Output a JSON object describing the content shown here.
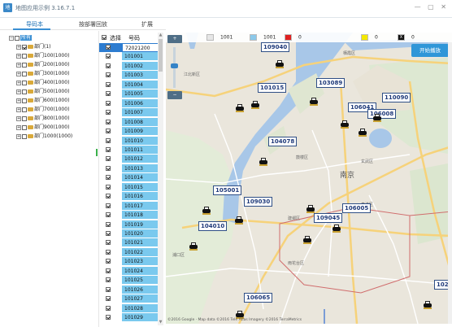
{
  "window": {
    "title": "地图应用示例 3.16.7.1",
    "app_icon_glyph": "地",
    "controls": "— ▢ ✕"
  },
  "tabs": [
    {
      "label": "导码本",
      "active": true
    },
    {
      "label": "按部署回放",
      "active": false
    },
    {
      "label": "扩展",
      "active": false
    }
  ],
  "tree": {
    "root_label": "所有",
    "items": [
      {
        "label": "部门(1)",
        "checked": true
      },
      {
        "label": "部门100(1000)",
        "checked": false
      },
      {
        "label": "部门200(1000)",
        "checked": false
      },
      {
        "label": "部门300(1000)",
        "checked": false
      },
      {
        "label": "部门400(1000)",
        "checked": false
      },
      {
        "label": "部门500(1000)",
        "checked": false
      },
      {
        "label": "部门600(1000)",
        "checked": false
      },
      {
        "label": "部门700(1000)",
        "checked": false
      },
      {
        "label": "部门800(1000)",
        "checked": false
      },
      {
        "label": "部门900(1000)",
        "checked": false
      },
      {
        "label": "部门1000(1000)",
        "checked": false
      }
    ]
  },
  "grid": {
    "header_select": "选择",
    "header_code": "号码",
    "rows": [
      "72021200",
      "101001",
      "101002",
      "101003",
      "101004",
      "101005",
      "101006",
      "101007",
      "101008",
      "101009",
      "101010",
      "101011",
      "101012",
      "101013",
      "101014",
      "101015",
      "101016",
      "101017",
      "101018",
      "101019",
      "101020",
      "101021",
      "101022",
      "101023",
      "101024",
      "101025",
      "101026",
      "101027",
      "101028",
      "101029"
    ]
  },
  "map": {
    "legend": [
      {
        "color": "#e6e6e6",
        "value": "1001"
      },
      {
        "color": "#8cc9ea",
        "value": "1001"
      },
      {
        "color": "#e02020",
        "value": "0"
      },
      {
        "color": "#f4e800",
        "value": "0"
      },
      {
        "color": "#111111",
        "value": "0",
        "glyph": "X"
      }
    ],
    "start_button": "开始播放",
    "zoom_in": "+",
    "zoom_out": "−",
    "city": "南京",
    "copyright": "©2016 Google · Map data ©2016 Tele Atlas Imagery ©2016 TerraMetrics",
    "vehicle_labels": [
      "109040",
      "103089",
      "101015",
      "106041",
      "110090",
      "106008",
      "104078",
      "105001",
      "109030",
      "104010",
      "109045",
      "106005",
      "106065",
      "102"
    ],
    "place_labels": [
      "栖霞区",
      "江北新区",
      "玄武区",
      "鼓楼区",
      "建邺区",
      "秦淮区",
      "雨花台区",
      "浦口区"
    ]
  }
}
